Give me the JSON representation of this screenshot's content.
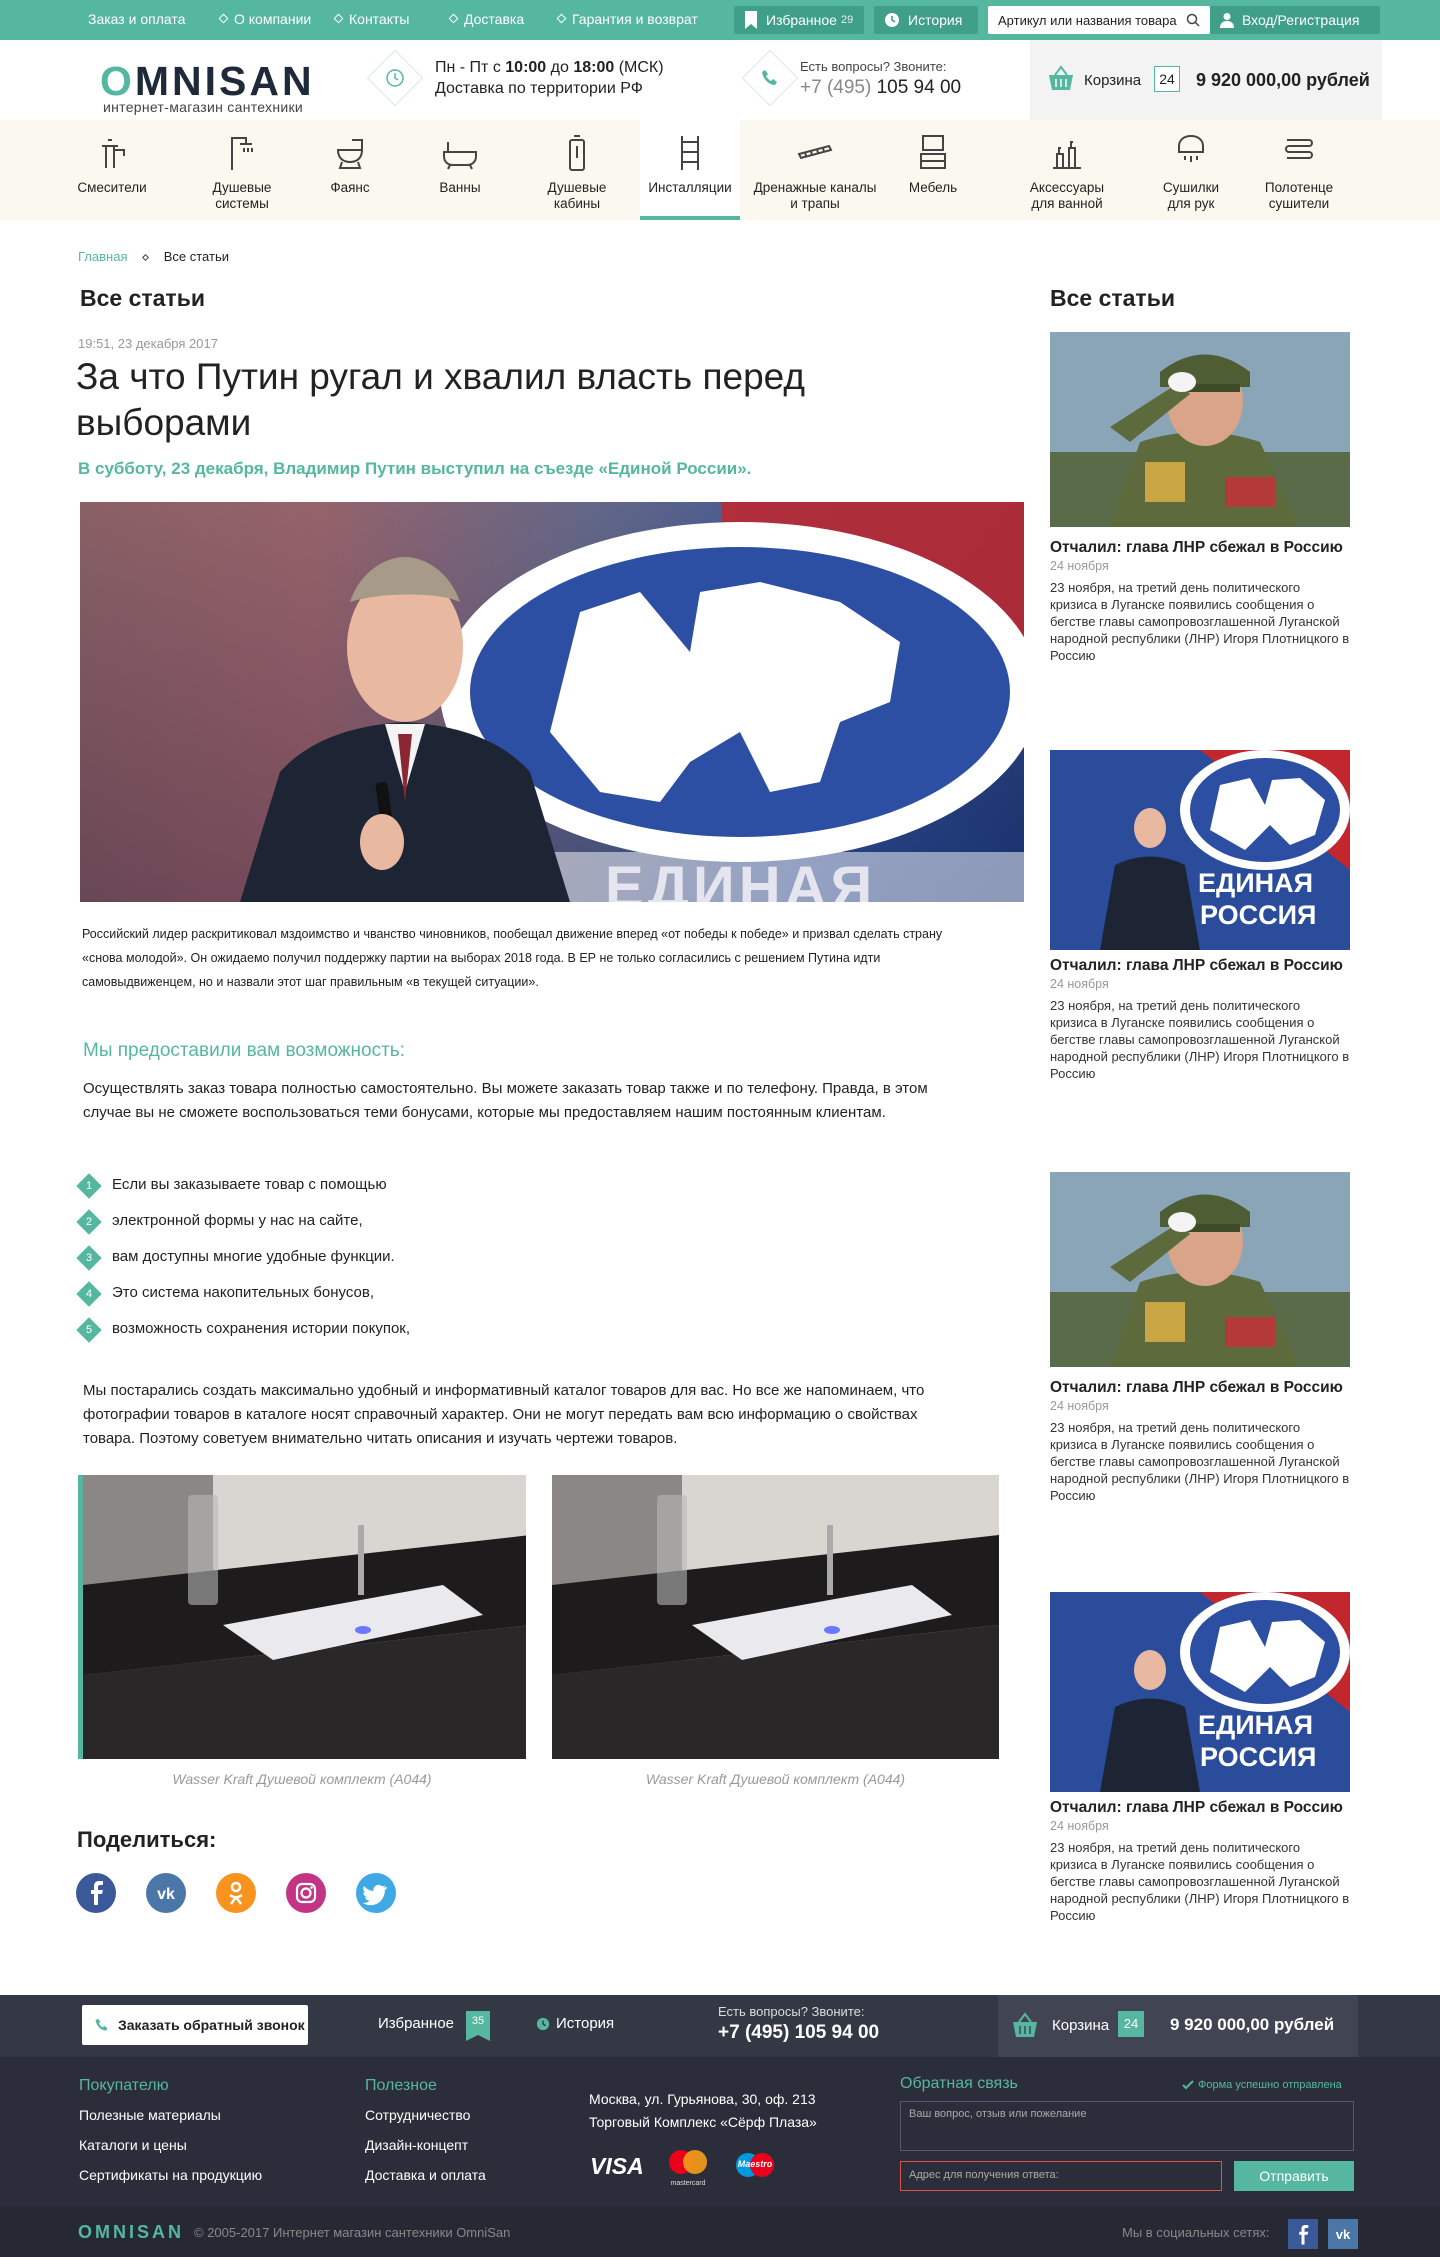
{
  "topbar": {
    "nav": [
      "Заказ и оплата",
      "О компании",
      "Контакты",
      "Доставка",
      "Гарантия и возврат"
    ],
    "favorites_label": "Избранное",
    "favorites_count": "29",
    "history_label": "История",
    "search_placeholder": "Артикул или названия товара",
    "login_label": "Вход/Регистрация"
  },
  "header": {
    "logo_pre": "O",
    "logo_main": "MNISAN",
    "logo_sub": "интернет-магазин сантехники",
    "hours_prefix": "Пн - Пт с ",
    "hours_from": "10:00",
    "hours_mid": " до ",
    "hours_to": "18:00",
    "hours_tz": " (МСК)",
    "delivery": "Доставка по территории РФ",
    "phone_label": "Есть вопросы? Звоните:",
    "phone_code": "+7 (495)",
    "phone_number": "105 94 00",
    "cart_label": "Корзина",
    "cart_count": "24",
    "cart_total": "9 920 000,00 рублей"
  },
  "categories": [
    {
      "label": "Смесители",
      "icon": "faucet-icon"
    },
    {
      "label": "Душевые системы",
      "icon": "shower-icon"
    },
    {
      "label": "Фаянс",
      "icon": "toilet-icon"
    },
    {
      "label": "Ванны",
      "icon": "bathtub-icon"
    },
    {
      "label": "Душевые кабины",
      "icon": "shower-cabin-icon"
    },
    {
      "label": "Инсталляции",
      "icon": "installation-icon",
      "active": true
    },
    {
      "label": "Дренажные каналы и трапы",
      "icon": "drain-icon"
    },
    {
      "label": "Мебель",
      "icon": "furniture-icon"
    },
    {
      "label": "Аксессуары для ванной",
      "icon": "accessories-icon"
    },
    {
      "label": "Сушилки для рук",
      "icon": "hand-dryer-icon"
    },
    {
      "label": "Полотенце сушители",
      "icon": "towel-dryer-icon"
    }
  ],
  "breadcrumb": {
    "home": "Главная",
    "current": "Все статьи"
  },
  "article": {
    "section_title": "Все статьи",
    "date": "19:51, 23 декабря 2017",
    "title": "За что Путин ругал и хвалил власть перед выборами",
    "lead": "В субботу, 23 декабря, Владимир Путин выступил на съезде «Единой России».",
    "image_text": "ЕДИНАЯ",
    "body": "Российский лидер раскритиковал мздоимство и чванство чиновников, пообещал движение вперед «от победы к победе» и призвал сделать страну «снова молодой». Он ожидаемо получил поддержку партии на выборах 2018 года. В ЕР не только согласились с решением Путина идти самовыдвиженцем, но и назвали этот шаг правильным «в текущей ситуации».",
    "subheading": "Мы предоставили вам возможность:",
    "para1": "Осуществлять заказ товара полностью самостоятельно. Вы можете заказать товар также и по телефону. Правда, в этом случае вы не сможете воспользоваться теми бонусами, которые мы предоставляем нашим постоянным клиентам.",
    "list": [
      {
        "n": "1",
        "text": "Если вы заказываете товар с помощью"
      },
      {
        "n": "2",
        "text": "электронной формы у нас на сайте,"
      },
      {
        "n": "3",
        "text": "вам доступны многие удобные функции."
      },
      {
        "n": "4",
        "text": "Это система накопительных бонусов,"
      },
      {
        "n": "5",
        "text": "возможность сохранения истории покупок,"
      }
    ],
    "para2": "Мы постарались создать максимально удобный и информативный каталог товаров для вас. Но все же напоминаем, что фотографии товаров в каталоге носят справочный характер. Они не могут передать вам всю информацию о свойствах товара. Поэтому советуем внимательно читать описания и изучать чертежи товаров.",
    "captions": [
      "Wasser Kraft Душевой комплект (A044)",
      "Wasser Kraft Душевой комплект (A044)"
    ],
    "share_title": "Поделиться:",
    "share": [
      "facebook-icon",
      "vk-icon",
      "odnoklassniki-icon",
      "instagram-icon",
      "twitter-icon"
    ]
  },
  "sidebar": {
    "title": "Все статьи",
    "items": [
      {
        "title": "Отчалил: глава ЛНР сбежал в Россию",
        "date": "24 ноября",
        "text": "23 ноября, на третий день политического кризиса в Луганске появились сообщения о бегстве главы самопровозглашенной Луганской народной республики (ЛНР) Игоря Плотницкого в Россию",
        "img": "soldier"
      },
      {
        "title": "Отчалил: глава ЛНР сбежал в Россию",
        "date": "24 ноября",
        "text": "23 ноября, на третий день политического кризиса в Луганске появились сообщения о бегстве главы самопровозглашенной Луганской народной республики (ЛНР) Игоря Плотницкого в Россию",
        "img": "speaker"
      },
      {
        "title": "Отчалил: глава ЛНР сбежал в Россию",
        "date": "24 ноября",
        "text": "23 ноября, на третий день политического кризиса в Луганске появились сообщения о бегстве главы самопровозглашенной Луганской народной республики (ЛНР) Игоря Плотницкого в Россию",
        "img": "soldier"
      },
      {
        "title": "Отчалил: глава ЛНР сбежал в Россию",
        "date": "24 ноября",
        "text": "23 ноября, на третий день политического кризиса в Луганске появились сообщения о бегстве главы самопровозглашенной Луганской народной республики (ЛНР) Игоря Плотницкого в Россию",
        "img": "speaker"
      }
    ],
    "speaker_text_1": "ЕДИНАЯ",
    "speaker_text_2": "РОССИЯ"
  },
  "footer": {
    "callback": "Заказать обратный звонок",
    "favorites": "Избранное",
    "favorites_count": "35",
    "history": "История",
    "phone_label": "Есть вопросы? Звоните:",
    "phone": "+7 (495) 105 94 00",
    "cart_label": "Корзина",
    "cart_count": "24",
    "cart_total": "9 920 000,00 рублей",
    "buyer_title": "Покупателю",
    "buyer_links": [
      "Полезные материалы",
      "Каталоги и цены",
      "Сертификаты на продукцию"
    ],
    "useful_title": "Полезное",
    "useful_links": [
      "Сотрудничество",
      "Дизайн-концепт",
      "Доставка и оплата"
    ],
    "address1": "Москва, ул. Гурьянова, 30, оф. 213",
    "address2": "Торговый Комплекс «Сёрф Плаза»",
    "pay_visa": "VISA",
    "pay_mc": "mastercard",
    "pay_maestro": "Maestro",
    "feedback_title": "Обратная связь",
    "feedback_success": "Форма успешно отправлена",
    "feedback_placeholder": "Ваш вопрос, отзыв или пожелание",
    "address_placeholder": "Адрес для получения ответа:",
    "send": "Отправить",
    "logo": "OMNISAN",
    "copyright": "© 2005-2017 Интернет магазин сантехники OmniSan",
    "social_label": "Мы в социальных сетях:"
  },
  "colors": {
    "accent": "#55b7a0",
    "dark": "#2b2e3a",
    "error": "#d9534f"
  }
}
